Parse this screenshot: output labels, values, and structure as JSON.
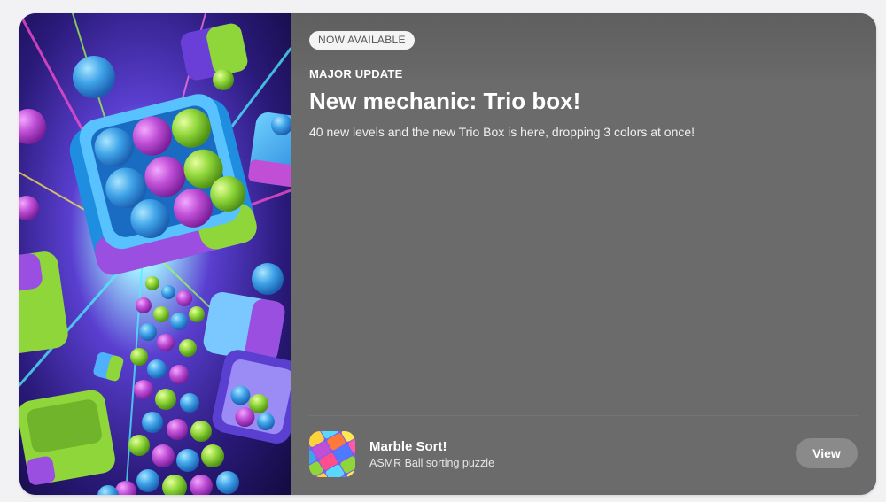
{
  "card": {
    "badge": "NOW AVAILABLE",
    "eyebrow": "MAJOR UPDATE",
    "headline": "New mechanic: Trio box!",
    "description": "40 new levels and the new Trio Box is here, dropping 3 colors at once!"
  },
  "app": {
    "name": "Marble Sort!",
    "subtitle": "ASMR Ball sorting puzzle",
    "action_label": "View"
  },
  "colors": {
    "card_bg": "#6b6b6b",
    "button_bg": "#8a8a8a",
    "ball_blue": "#3fa3e8",
    "ball_purple": "#c04fd6",
    "ball_green": "#8fd63a"
  }
}
